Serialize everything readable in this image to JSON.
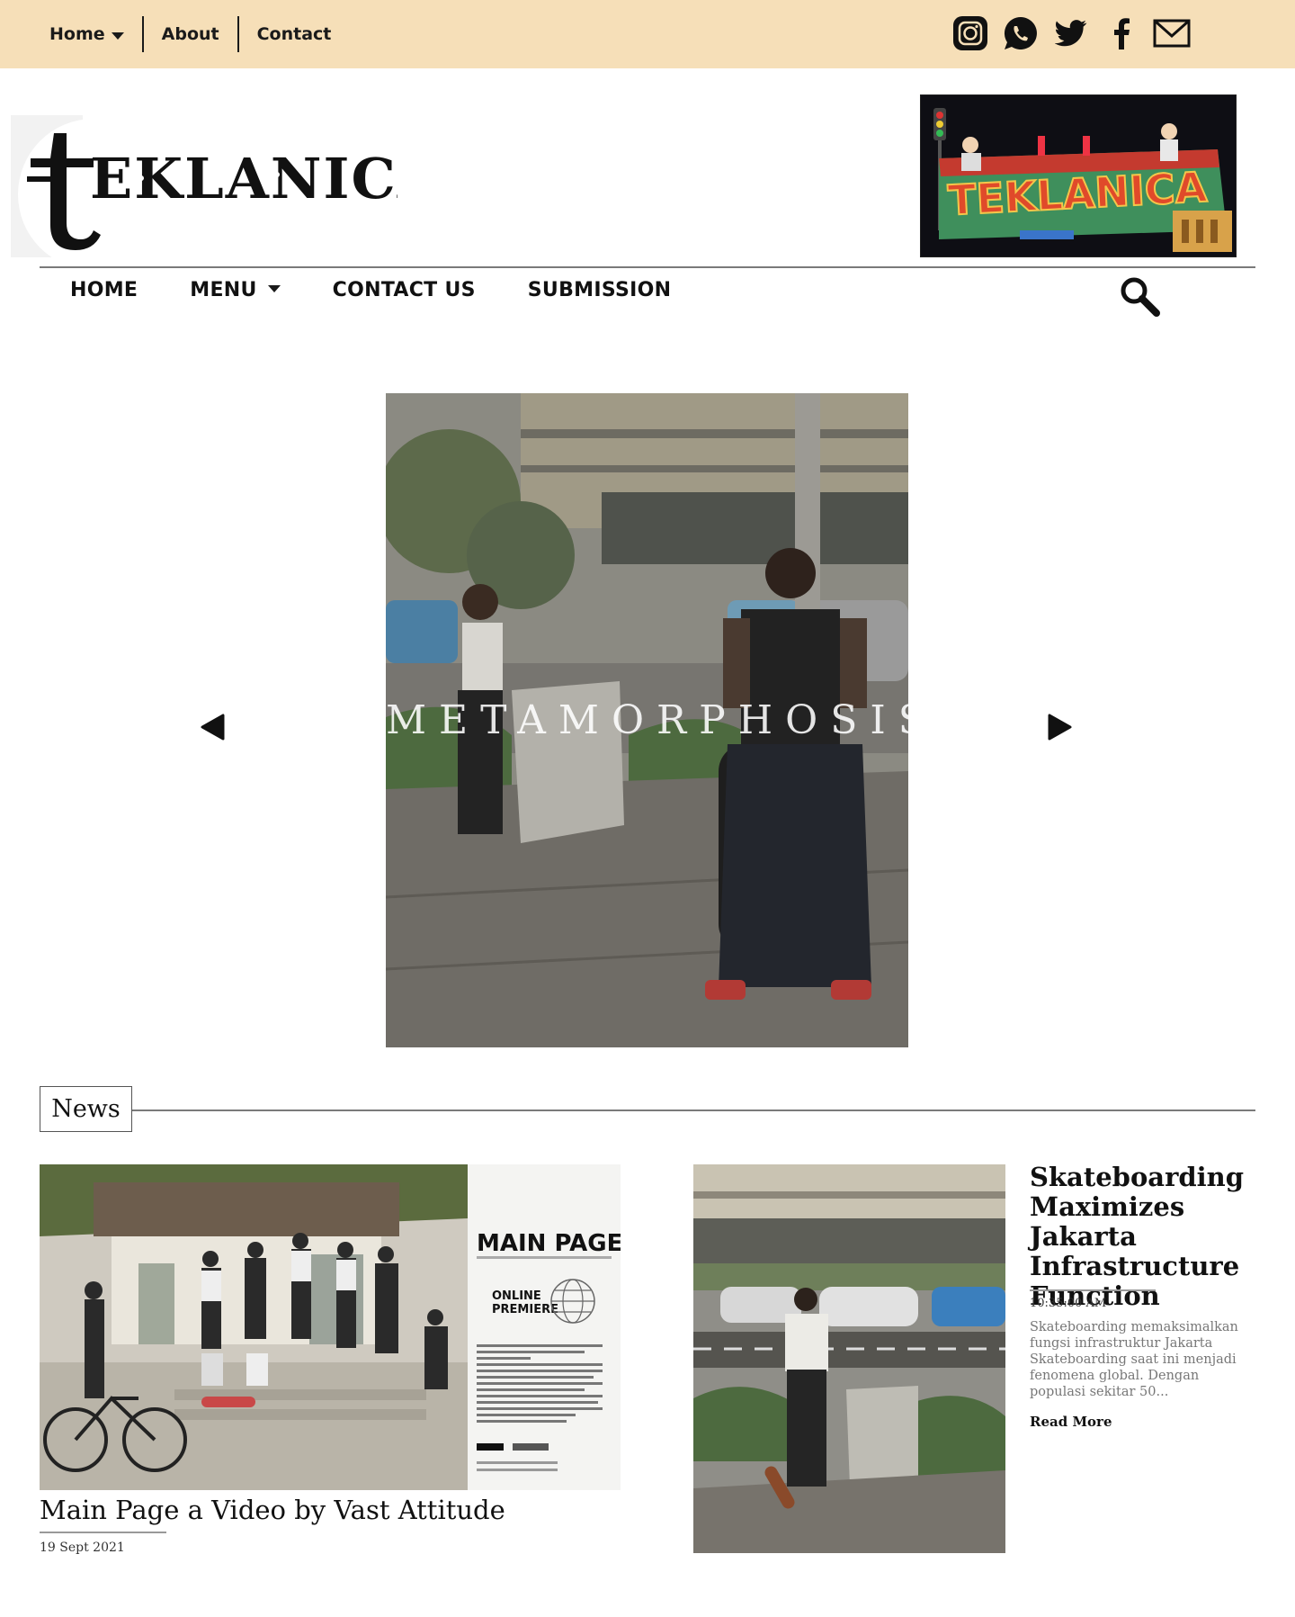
{
  "topbar": {
    "background": "#f6dfb8",
    "nav": [
      "Home",
      "About",
      "Contact"
    ],
    "social_icons": [
      "instagram-icon",
      "whatsapp-icon",
      "twitter-icon",
      "facebook-icon",
      "mail-icon"
    ]
  },
  "header": {
    "logo_text": "tEKLANICA",
    "banner_text": "TEKLANICA"
  },
  "main_nav": {
    "items": [
      "HOME",
      "MENU",
      "CONTACT US",
      "SUBMISSION"
    ],
    "search_icon": "search-icon"
  },
  "slider": {
    "title": "METAMORPHOSIS",
    "prev_icon": "triangle-left-icon",
    "next_icon": "triangle-right-icon"
  },
  "news": {
    "section_label": "News",
    "cards": [
      {
        "title": "Main Page a Video by Vast Attitude",
        "date": "19 Sept 2021",
        "poster_heading": "MAIN PAGE",
        "poster_sub": "ONLINE PREMIERE"
      },
      {
        "title": "Skateboarding Maximizes Jakarta Infrastructure Function",
        "time": "10:35:00 AM",
        "excerpt": "Skateboarding memaksimalkan fungsi infrastruktur Jakarta Skateboarding saat ini menjadi fenomena global. Dengan populasi sekitar 50...",
        "read_more": "Read More"
      }
    ]
  }
}
